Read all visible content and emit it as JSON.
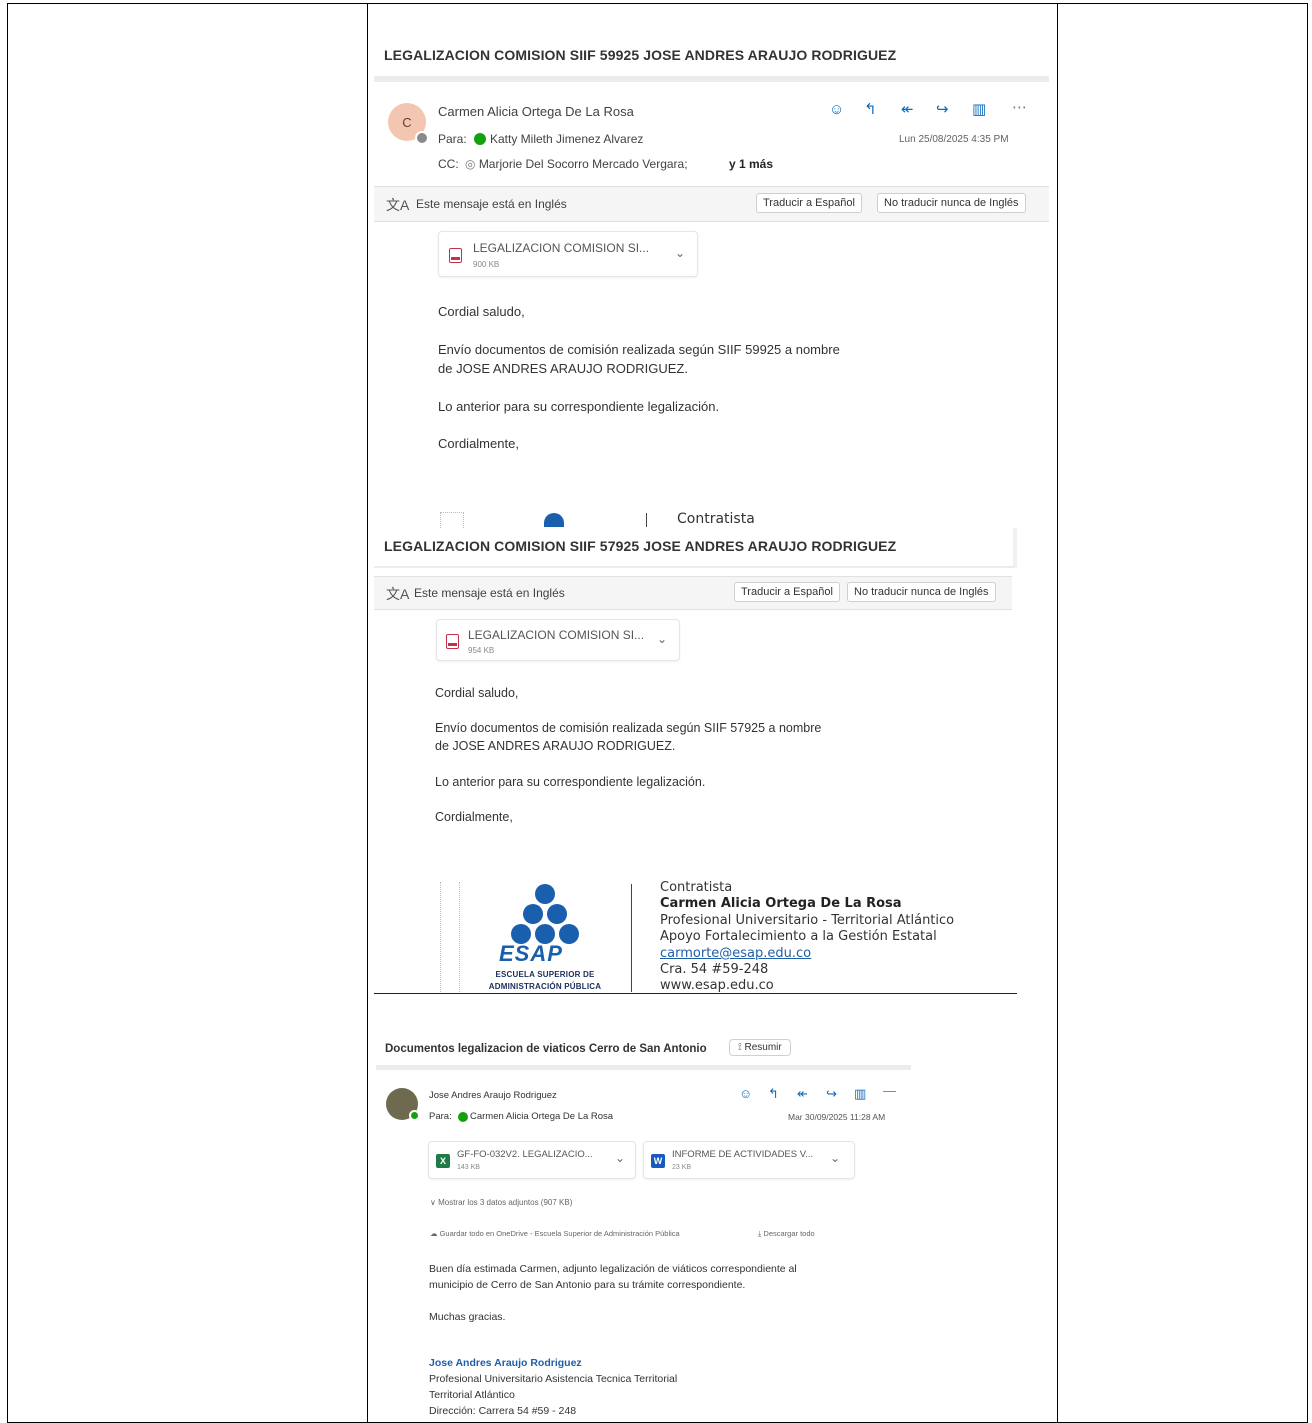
{
  "email1": {
    "subject": "LEGALIZACION COMISION SIIF 59925 JOSE ANDRES ARAUJO RODRIGUEZ",
    "avatar_initial": "C",
    "sender": "Carmen Alicia Ortega De La Rosa",
    "to_label": "Para:",
    "to_name": "Katty Mileth Jimenez Alvarez",
    "cc_label": "CC:",
    "cc_name": "Marjorie Del Socorro Mercado Vergara;",
    "cc_more": "y 1 más",
    "date": "Lun 25/08/2025 4:35 PM",
    "translate_notice": "Este mensaje está en Inglés",
    "translate_btn": "Traducir a Español",
    "never_translate_btn": "No traducir nunca de Inglés",
    "attachment_name": "LEGALIZACION COMISION SI...",
    "attachment_size": "900 KB",
    "greeting": "Cordial saludo,",
    "line1": "Envío documentos de comisión realizada según SIIF 59925 a nombre",
    "line2": "de JOSE ANDRES ARAUJO RODRIGUEZ.",
    "line3": "Lo anterior para su correspondiente legalización.",
    "closing": "Cordialmente,",
    "sig_partial": "Contratista"
  },
  "email2": {
    "subject": "LEGALIZACION COMISION SIIF 57925 JOSE ANDRES ARAUJO RODRIGUEZ",
    "translate_notice": "Este mensaje está en Inglés",
    "translate_btn": "Traducir a Español",
    "never_translate_btn": "No traducir nunca de Inglés",
    "attachment_name": "LEGALIZACION COMISION SI...",
    "attachment_size": "954 KB",
    "greeting": "Cordial saludo,",
    "line1": "Envío documentos de comisión realizada según SIIF 57925 a nombre",
    "line2": "de JOSE ANDRES ARAUJO RODRIGUEZ.",
    "line3": "Lo anterior para su correspondiente legalización.",
    "closing": "Cordialmente,",
    "signature": {
      "role": "Contratista",
      "name": "Carmen Alicia Ortega De La Rosa",
      "title": "Profesional Universitario - Territorial Atlántico",
      "dept": "Apoyo Fortalecimiento a la Gestión Estatal",
      "email": "carmorte@esap.edu.co",
      "address": "Cra. 54 #59-248",
      "web": "www.esap.edu.co",
      "logo_word": "ESAP",
      "logo_caption1": "ESCUELA SUPERIOR DE",
      "logo_caption2": "ADMINISTRACIÓN PÚBLICA"
    }
  },
  "email3": {
    "subject": "Documentos legalizacion de viaticos Cerro de San Antonio",
    "summary_btn": "Resumir",
    "sender": "Jose Andres Araujo Rodriguez",
    "to_label": "Para:",
    "to_name": "Carmen Alicia Ortega De La Rosa",
    "date": "Mar 30/09/2025 11:28 AM",
    "attachment1_name": "GF-FO-032V2. LEGALIZACIO...",
    "attachment1_size": "143 KB",
    "attachment2_name": "INFORME DE ACTIVIDADES V...",
    "attachment2_size": "23 KB",
    "show_all": "Mostrar los 3 datos adjuntos (907 KB)",
    "save_onedrive": "Guardar todo en OneDrive - Escuela Superior de Administración Pública",
    "download_all": "Descargar todo",
    "line1": "Buen día estimada Carmen, adjunto legalización de viáticos correspondiente al",
    "line2": "municipio de Cerro de San Antonio para su trámite correspondiente.",
    "thanks": "Muchas gracias.",
    "sig_name": "Jose Andres Araujo Rodriguez",
    "sig_title": "Profesional Universitario Asistencia Tecnica Territorial",
    "sig_unit": "Territorial Atlántico",
    "sig_address": "Dirección: Carrera 54 #59 - 248"
  },
  "colors": {
    "accent": "#0f6cbd",
    "presence_green": "#13a10e",
    "pdf_red": "#c4314b",
    "esap_blue": "#1a5fae"
  }
}
